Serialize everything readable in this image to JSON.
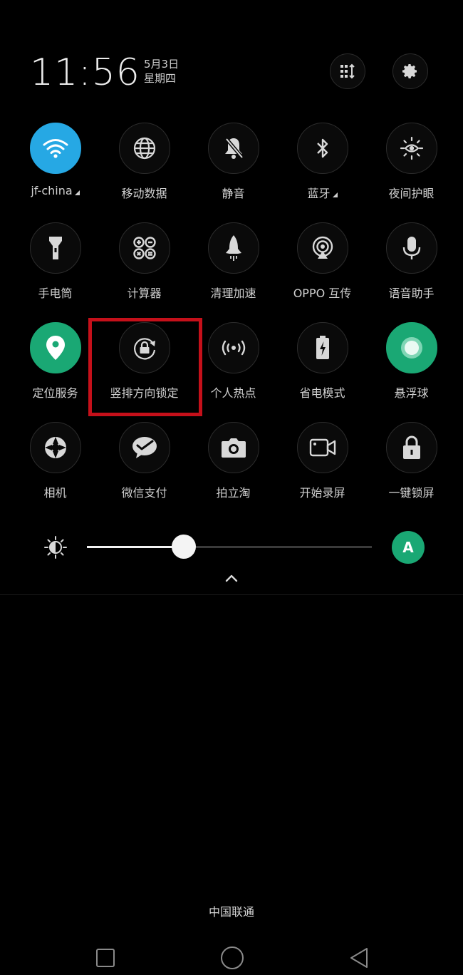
{
  "header": {
    "time": "11:56",
    "date": "5月3日",
    "weekday": "星期四"
  },
  "toggles": [
    [
      {
        "label": "jf-china",
        "icon": "wifi-icon",
        "state": "on",
        "color": "#26a8e4",
        "has_submenu": true
      },
      {
        "label": "移动数据",
        "icon": "globe-icon",
        "state": "off"
      },
      {
        "label": "静音",
        "icon": "mute-bell-icon",
        "state": "off"
      },
      {
        "label": "蓝牙",
        "icon": "bluetooth-icon",
        "state": "off",
        "has_submenu": true
      },
      {
        "label": "夜间护眼",
        "icon": "eye-sun-icon",
        "state": "off"
      }
    ],
    [
      {
        "label": "手电筒",
        "icon": "flashlight-icon",
        "state": "off"
      },
      {
        "label": "计算器",
        "icon": "calculator-icon",
        "state": "off"
      },
      {
        "label": "清理加速",
        "icon": "rocket-icon",
        "state": "off"
      },
      {
        "label": "OPPO 互传",
        "icon": "share-signal-icon",
        "state": "off"
      },
      {
        "label": "语音助手",
        "icon": "microphone-icon",
        "state": "off"
      }
    ],
    [
      {
        "label": "定位服务",
        "icon": "location-pin-icon",
        "state": "on",
        "color": "#1aa874"
      },
      {
        "label": "竖排方向锁定",
        "icon": "rotation-lock-icon",
        "state": "off",
        "highlighted": true
      },
      {
        "label": "个人热点",
        "icon": "hotspot-icon",
        "state": "off"
      },
      {
        "label": "省电模式",
        "icon": "battery-icon",
        "state": "off"
      },
      {
        "label": "悬浮球",
        "icon": "floating-ball-icon",
        "state": "on",
        "color": "#1aa874"
      }
    ],
    [
      {
        "label": "相机",
        "icon": "camera-aperture-icon",
        "state": "off"
      },
      {
        "label": "微信支付",
        "icon": "wechat-pay-icon",
        "state": "off"
      },
      {
        "label": "拍立淘",
        "icon": "camera-icon",
        "state": "off"
      },
      {
        "label": "开始录屏",
        "icon": "video-record-icon",
        "state": "off"
      },
      {
        "label": "一键锁屏",
        "icon": "padlock-icon",
        "state": "off"
      }
    ]
  ],
  "brightness": {
    "level": 0.34,
    "auto_label": "A",
    "auto_color": "#1aa874"
  },
  "footer": {
    "carrier": "中国联通"
  },
  "navigation": [
    "recent-apps",
    "home",
    "back"
  ]
}
